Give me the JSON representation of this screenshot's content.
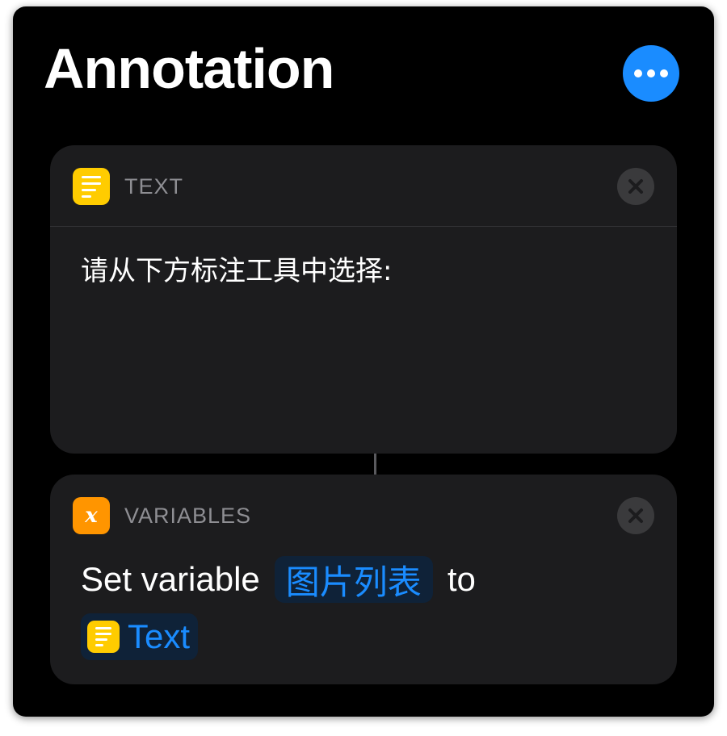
{
  "window": {
    "title": "Annotation",
    "more_icon": "ellipsis-icon"
  },
  "colors": {
    "accent": "#1a8cff",
    "text_icon": "#ffcc00",
    "variables_icon": "#ff9500",
    "card_bg": "#1c1c1e",
    "window_bg": "#000000"
  },
  "actions": [
    {
      "category": "TEXT",
      "icon": "text-lines-icon",
      "content": "请从下方标注工具中选择:",
      "close_icon": "close-icon"
    },
    {
      "category": "VARIABLES",
      "icon": "variable-x-icon",
      "icon_glyph": "x",
      "prefix": "Set variable",
      "variable_name": "图片列表",
      "connector": "to",
      "value_token": "Text",
      "value_icon": "text-lines-icon",
      "close_icon": "close-icon"
    }
  ]
}
